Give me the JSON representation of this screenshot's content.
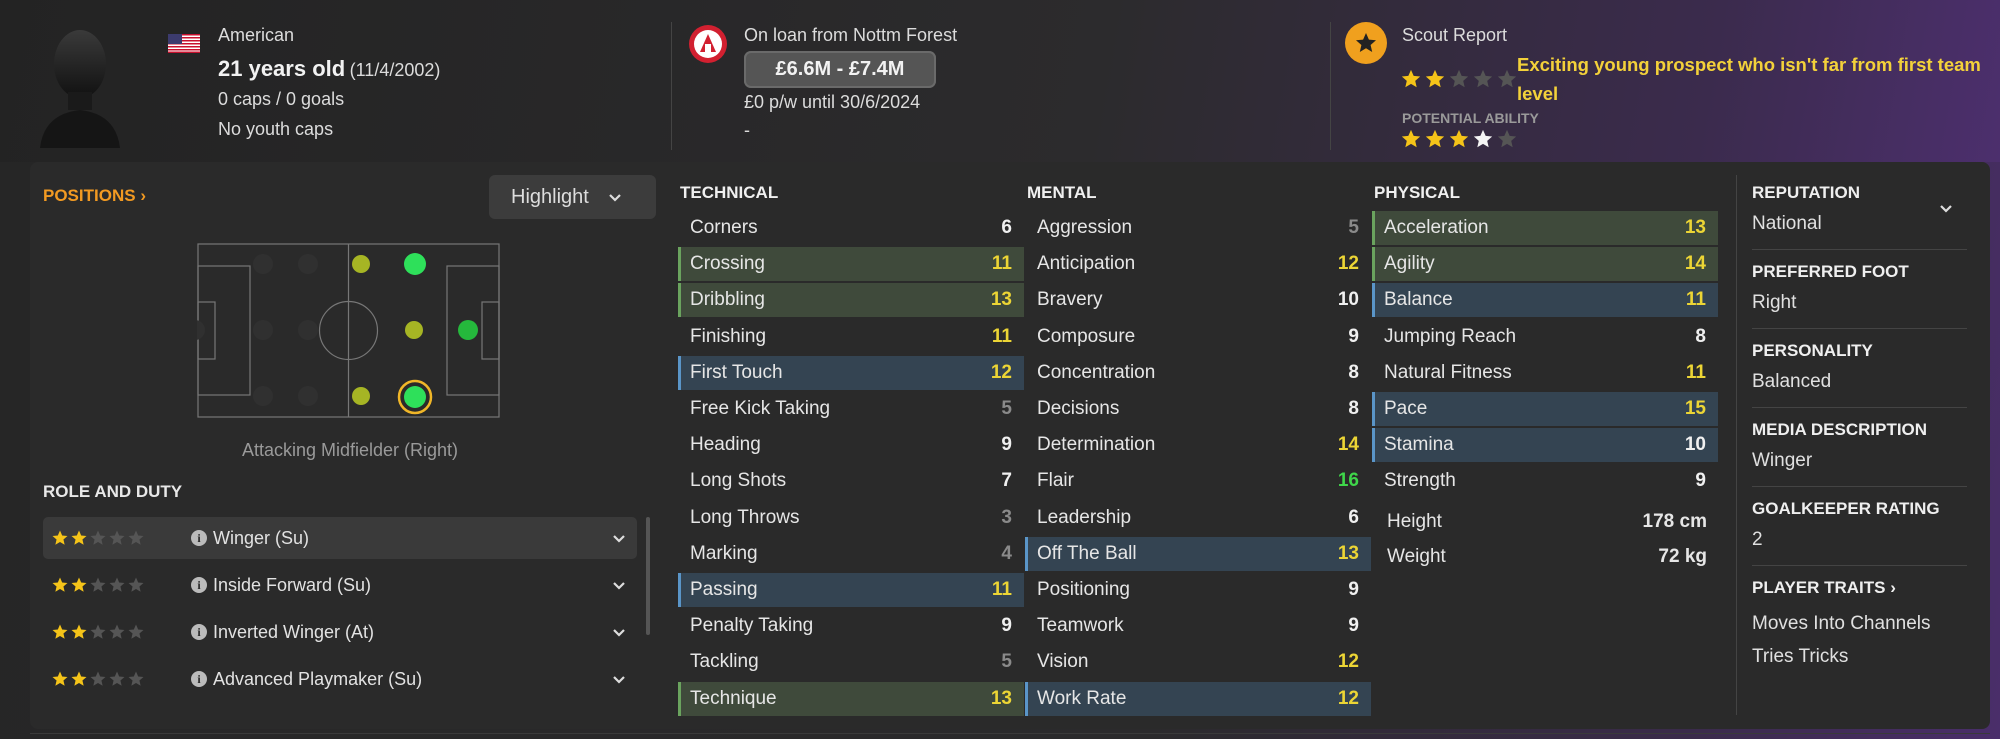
{
  "header": {
    "nationality": "American",
    "age": "21 years old",
    "dob": "(11/4/2002)",
    "caps": "0 caps / 0 goals",
    "youth": "No youth caps",
    "loan": "On loan from Nottm Forest",
    "value": "£6.6M - £7.4M",
    "wage": "£0 p/w until 30/6/2024",
    "extra": "-",
    "scout_title": "Scout Report",
    "current_ability_stars": 2,
    "scout_text": "Exciting young prospect who isn't far from first team level",
    "potential_label": "POTENTIAL ABILITY",
    "potential_ability_stars": 3.5
  },
  "positions": {
    "title": "POSITIONS",
    "highlight_label": "Highlight",
    "current_position": "Attacking Midfielder (Right)"
  },
  "roles": {
    "title": "ROLE AND DUTY",
    "items": [
      {
        "name": "Winger (Su)",
        "stars": 2
      },
      {
        "name": "Inside Forward (Su)",
        "stars": 2
      },
      {
        "name": "Inverted Winger (At)",
        "stars": 2
      },
      {
        "name": "Advanced Playmaker (Su)",
        "stars": 2
      }
    ]
  },
  "technical": {
    "title": "TECHNICAL",
    "rows": [
      {
        "name": "Corners",
        "value": "6"
      },
      {
        "name": "Crossing",
        "value": "11"
      },
      {
        "name": "Dribbling",
        "value": "13"
      },
      {
        "name": "Finishing",
        "value": "11"
      },
      {
        "name": "First Touch",
        "value": "12"
      },
      {
        "name": "Free Kick Taking",
        "value": "5"
      },
      {
        "name": "Heading",
        "value": "9"
      },
      {
        "name": "Long Shots",
        "value": "7"
      },
      {
        "name": "Long Throws",
        "value": "3"
      },
      {
        "name": "Marking",
        "value": "4"
      },
      {
        "name": "Passing",
        "value": "11"
      },
      {
        "name": "Penalty Taking",
        "value": "9"
      },
      {
        "name": "Tackling",
        "value": "5"
      },
      {
        "name": "Technique",
        "value": "13"
      }
    ]
  },
  "mental": {
    "title": "MENTAL",
    "rows": [
      {
        "name": "Aggression",
        "value": "5"
      },
      {
        "name": "Anticipation",
        "value": "12"
      },
      {
        "name": "Bravery",
        "value": "10"
      },
      {
        "name": "Composure",
        "value": "9"
      },
      {
        "name": "Concentration",
        "value": "8"
      },
      {
        "name": "Decisions",
        "value": "8"
      },
      {
        "name": "Determination",
        "value": "14"
      },
      {
        "name": "Flair",
        "value": "16"
      },
      {
        "name": "Leadership",
        "value": "6"
      },
      {
        "name": "Off The Ball",
        "value": "13"
      },
      {
        "name": "Positioning",
        "value": "9"
      },
      {
        "name": "Teamwork",
        "value": "9"
      },
      {
        "name": "Vision",
        "value": "12"
      },
      {
        "name": "Work Rate",
        "value": "12"
      }
    ]
  },
  "physical": {
    "title": "PHYSICAL",
    "rows": [
      {
        "name": "Acceleration",
        "value": "13"
      },
      {
        "name": "Agility",
        "value": "14"
      },
      {
        "name": "Balance",
        "value": "11"
      },
      {
        "name": "Jumping Reach",
        "value": "8"
      },
      {
        "name": "Natural Fitness",
        "value": "11"
      },
      {
        "name": "Pace",
        "value": "15"
      },
      {
        "name": "Stamina",
        "value": "10"
      },
      {
        "name": "Strength",
        "value": "9"
      }
    ],
    "height_label": "Height",
    "height": "178 cm",
    "weight_label": "Weight",
    "weight": "72 kg"
  },
  "side": {
    "reputation_label": "REPUTATION",
    "reputation": "National",
    "foot_label": "PREFERRED FOOT",
    "foot": "Right",
    "personality_label": "PERSONALITY",
    "personality": "Balanced",
    "media_label": "MEDIA DESCRIPTION",
    "media": "Winger",
    "gk_label": "GOALKEEPER RATING",
    "gk": "2",
    "traits_label": "PLAYER TRAITS",
    "traits": [
      "Moves Into Channels",
      "Tries Tricks"
    ]
  },
  "colors": {
    "accent_orange": "#f29a22",
    "star_gold": "#f5c419",
    "value_yellow": "#ecd535",
    "value_green": "#3fd64a",
    "scout_text": "#f3d13a"
  }
}
